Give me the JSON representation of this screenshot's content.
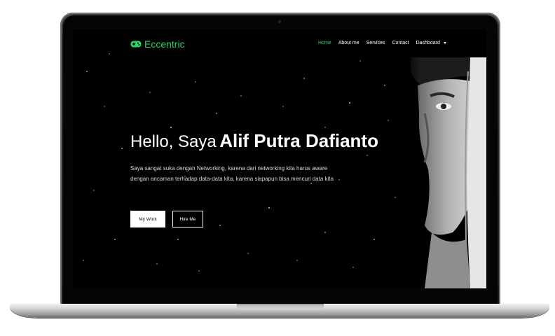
{
  "brand": {
    "name": "Eccentric",
    "icon": "gamepad-icon",
    "color": "#2bd36b"
  },
  "nav": {
    "items": [
      {
        "label": "Home",
        "active": true
      },
      {
        "label": "About me"
      },
      {
        "label": "Services"
      },
      {
        "label": "Contact"
      },
      {
        "label": "Dashboard",
        "dropdown": true
      }
    ]
  },
  "hero": {
    "greeting": "Hello, Saya",
    "name": "Alif Putra Dafianto",
    "description": "Saya sangat suka dengan Networking, karena dari networking kita harus aware dengan ancaman terhadap data-data kita, karena siapapun bisa mencuri data kita",
    "primary_button": "My Work",
    "secondary_button": "Hire Me"
  },
  "colors": {
    "accent": "#2bd36b",
    "background": "#000000",
    "text": "#ffffff"
  }
}
